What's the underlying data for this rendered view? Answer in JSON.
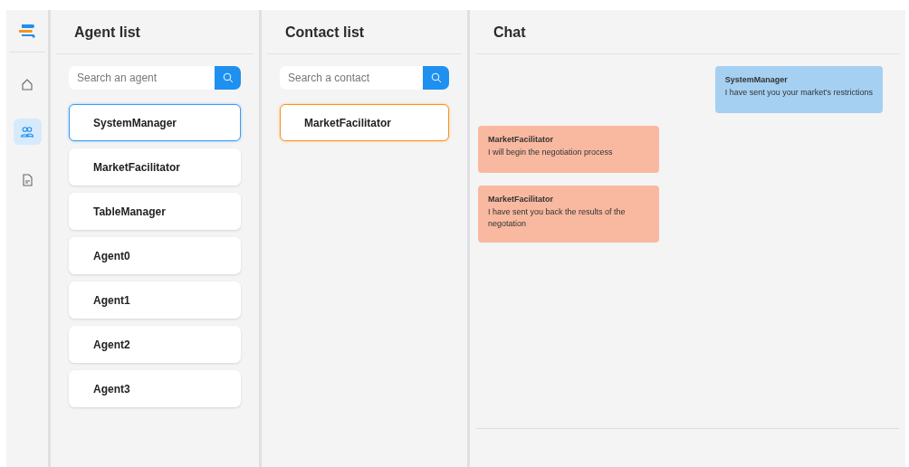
{
  "nav": [
    {
      "kind": "home",
      "selected": false
    },
    {
      "kind": "users",
      "selected": true
    },
    {
      "kind": "document",
      "selected": false
    }
  ],
  "agent_list": {
    "title": "Agent list",
    "search": {
      "placeholder": "Search an agent"
    },
    "items": [
      {
        "label": "SystemManager",
        "selected": true
      },
      {
        "label": "MarketFacilitator",
        "selected": false
      },
      {
        "label": "TableManager",
        "selected": false
      },
      {
        "label": "Agent0",
        "selected": false
      },
      {
        "label": "Agent1",
        "selected": false
      },
      {
        "label": "Agent2",
        "selected": false
      },
      {
        "label": "Agent3",
        "selected": false
      }
    ]
  },
  "contact_list": {
    "title": "Contact list",
    "search": {
      "placeholder": "Search a contact"
    },
    "items": [
      {
        "label": "MarketFacilitator",
        "selected": true
      }
    ]
  },
  "chat": {
    "title": "Chat",
    "messages": [
      {
        "kind": "sent",
        "sender": "SystemManager",
        "text": "I have sent you your market's restrictions"
      },
      {
        "kind": "received",
        "sender": "MarketFacilitator",
        "text": "I will begin the negotiation process"
      },
      {
        "kind": "received",
        "sender": "MarketFacilitator",
        "text": "I have sent you back the results of the negotation"
      }
    ]
  }
}
